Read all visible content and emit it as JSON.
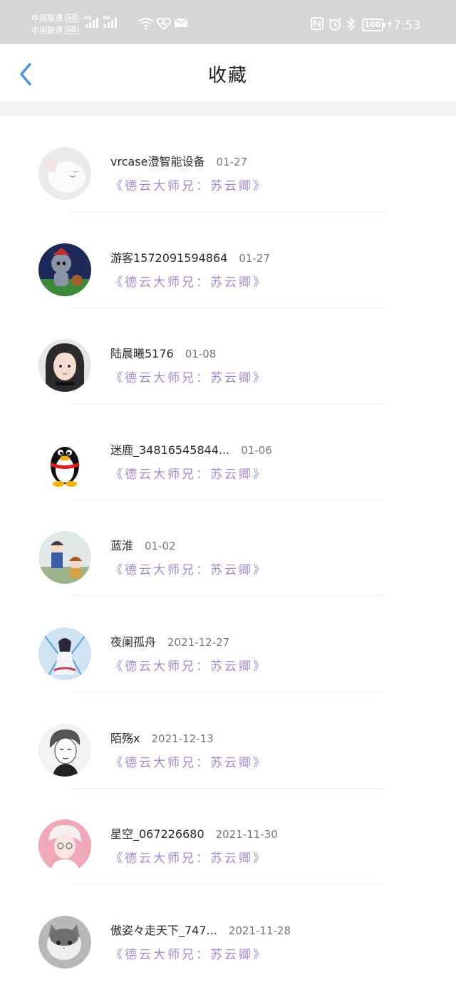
{
  "status_bar": {
    "carrier1": "中国联通",
    "carrier2": "中国联通",
    "hd": "HD",
    "net1": "4G",
    "net2": "5G",
    "battery": "100",
    "time": "7:53"
  },
  "header": {
    "title": "收藏"
  },
  "items": [
    {
      "name": "vrcase澄智能设备",
      "date": "01-27",
      "link": "《德云大师兄：苏云卿》"
    },
    {
      "name": "游客1572091594864",
      "date": "01-27",
      "link": "《德云大师兄：苏云卿》"
    },
    {
      "name": "陆晨曦5176",
      "date": "01-08",
      "link": "《德云大师兄：苏云卿》"
    },
    {
      "name": "迷鹿_34816545844...",
      "date": "01-06",
      "link": "《德云大师兄：苏云卿》"
    },
    {
      "name": "蓝淮",
      "date": "01-02",
      "link": "《德云大师兄：苏云卿》"
    },
    {
      "name": "夜阑孤舟",
      "date": "2021-12-27",
      "link": "《德云大师兄：苏云卿》"
    },
    {
      "name": "陌殇x",
      "date": "2021-12-13",
      "link": "《德云大师兄：苏云卿》"
    },
    {
      "name": "星空_067226680",
      "date": "2021-11-30",
      "link": "《德云大师兄：苏云卿》"
    },
    {
      "name": "傲姿々走天下_747...",
      "date": "2021-11-28",
      "link": "《德云大师兄：苏云卿》"
    }
  ],
  "colors": {
    "accent": "#4a90e2",
    "link": "#a38ad0",
    "status_bar": "#d6d6d6"
  }
}
